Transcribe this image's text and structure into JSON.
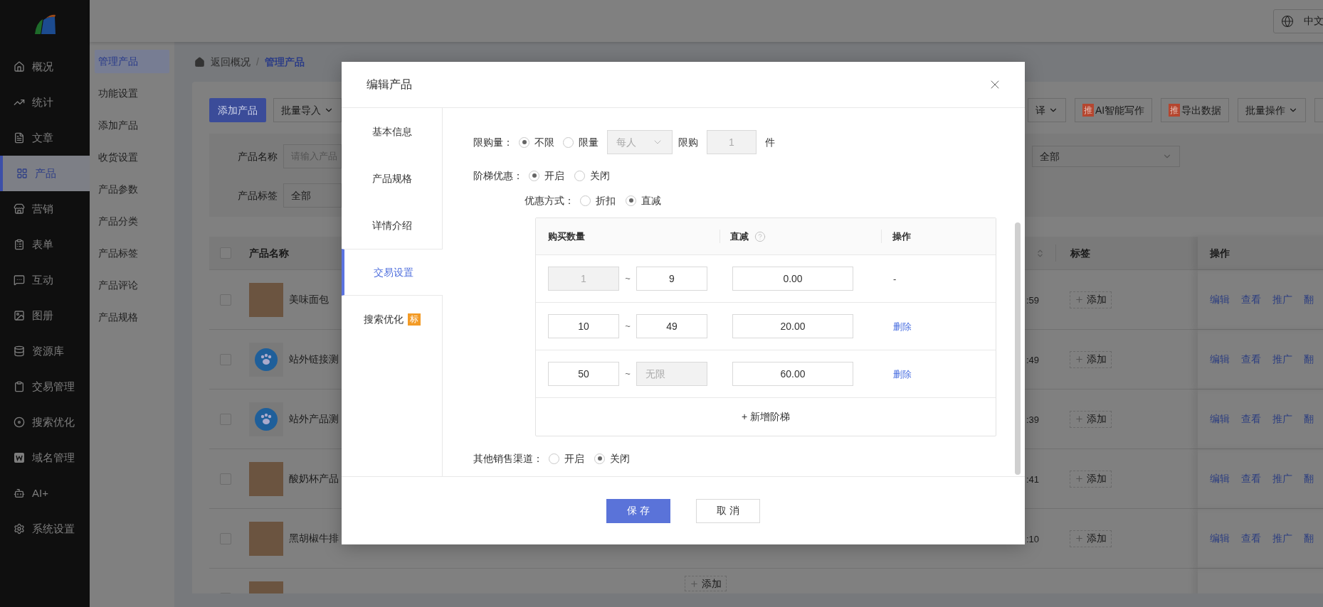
{
  "top_bar": {
    "language": "中文"
  },
  "nav": {
    "items": [
      {
        "label": "概况",
        "selected": false
      },
      {
        "label": "统计",
        "selected": false
      },
      {
        "label": "文章",
        "selected": false
      },
      {
        "label": "产品",
        "selected": true
      },
      {
        "label": "营销",
        "selected": false
      },
      {
        "label": "表单",
        "selected": false
      },
      {
        "label": "互动",
        "selected": false
      },
      {
        "label": "图册",
        "selected": false
      },
      {
        "label": "资源库",
        "selected": false
      },
      {
        "label": "交易管理",
        "selected": false
      },
      {
        "label": "搜索优化",
        "selected": false
      },
      {
        "label": "域名管理",
        "selected": false
      },
      {
        "label": "AI+",
        "selected": false
      },
      {
        "label": "系统设置",
        "selected": false
      }
    ]
  },
  "submenu": {
    "items": [
      {
        "label": "管理产品",
        "selected": true
      },
      {
        "label": "功能设置",
        "selected": false
      },
      {
        "label": "添加产品",
        "selected": false
      },
      {
        "label": "收货设置",
        "selected": false
      },
      {
        "label": "产品参数",
        "selected": false
      },
      {
        "label": "产品分类",
        "selected": false
      },
      {
        "label": "产品标签",
        "selected": false
      },
      {
        "label": "产品评论",
        "selected": false
      },
      {
        "label": "产品规格",
        "selected": false
      }
    ]
  },
  "breadcrumb": {
    "back": "返回概况",
    "separator": "/",
    "current": "管理产品"
  },
  "toolbar": {
    "left": [
      {
        "label": "添加产品",
        "kind": "primary"
      },
      {
        "label": "批量导入",
        "kind": "dropdown"
      }
    ],
    "right": [
      {
        "label": "译",
        "kind": "dropdown"
      },
      {
        "label": "AI智能写作",
        "kind": "promo",
        "badge": "推"
      },
      {
        "label": "导出数据",
        "kind": "promo",
        "badge": "推"
      },
      {
        "label": "批量操作",
        "kind": "dropdown"
      }
    ]
  },
  "filters": {
    "name": {
      "label": "产品名称",
      "placeholder": "请输入产品"
    },
    "tag": {
      "label": "产品标签",
      "value": "全部"
    },
    "other": {
      "value": "全部"
    }
  },
  "table": {
    "all_checked": false,
    "columns": {
      "name": "产品名称",
      "tag": "标签",
      "actions": "操作"
    },
    "rows": [
      {
        "checked": false,
        "kind": "photo",
        "name": "美味面包",
        "time": ":59",
        "tag_button": "添加",
        "actions": [
          "编辑",
          "查看",
          "推广",
          "翻"
        ]
      },
      {
        "checked": false,
        "kind": "logo",
        "name": "站外链接测",
        "time": ":49",
        "tag_button": "添加",
        "actions": [
          "编辑",
          "查看",
          "推广",
          "翻"
        ]
      },
      {
        "checked": false,
        "kind": "logo",
        "name": "站外产品测",
        "time": ":39",
        "tag_button": "添加",
        "actions": [
          "编辑",
          "查看",
          "推广",
          "翻"
        ]
      },
      {
        "checked": false,
        "kind": "photo",
        "name": "酸奶杯产品",
        "time": ":41",
        "tag_button": "添加",
        "actions": [
          "编辑",
          "查看",
          "推广",
          "翻"
        ]
      },
      {
        "checked": false,
        "kind": "photo",
        "name": "黑胡椒牛排",
        "time": ":10",
        "tag_button": "添加",
        "actions": [
          "编辑",
          "查看",
          "推广",
          "翻"
        ]
      },
      {
        "checked": false,
        "kind": "photo",
        "center_tag_button": "添加"
      }
    ]
  },
  "modal": {
    "title": "编辑产品",
    "tabs": [
      {
        "label": "基本信息",
        "selected": false
      },
      {
        "label": "产品规格",
        "selected": false
      },
      {
        "label": "详情介绍",
        "selected": false
      },
      {
        "label": "交易设置",
        "selected": true
      },
      {
        "label": "搜索优化",
        "selected": false,
        "badge": "标"
      }
    ],
    "purchase_limit": {
      "label": "限购量：",
      "options": [
        {
          "label": "不限",
          "selected": true
        },
        {
          "label": "限量",
          "selected": false
        }
      ],
      "per": {
        "value": "每人",
        "disabled": true
      },
      "limit_label": "限购",
      "limit": {
        "value": "1",
        "disabled": true
      },
      "unit": "件"
    },
    "tier_discount": {
      "label": "阶梯优惠：",
      "options": [
        {
          "label": "开启",
          "selected": true
        },
        {
          "label": "关闭",
          "selected": false
        }
      ]
    },
    "discount_mode": {
      "label": "优惠方式：",
      "options": [
        {
          "label": "折扣",
          "selected": false
        },
        {
          "label": "直减",
          "selected": true
        }
      ]
    },
    "tiers": {
      "columns": [
        "购买数量",
        "直减",
        "操作"
      ],
      "rows": [
        {
          "separator": "~",
          "min": {
            "value": "1",
            "disabled": true
          },
          "max": {
            "value": "9",
            "disabled": false
          },
          "amount": "0.00",
          "action": {
            "kind": "none",
            "label": "-"
          }
        },
        {
          "separator": "~",
          "min": {
            "value": "10",
            "disabled": false
          },
          "max": {
            "value": "49",
            "disabled": false
          },
          "amount": "20.00",
          "action": {
            "kind": "link",
            "label": "删除"
          }
        },
        {
          "separator": "~",
          "min": {
            "value": "50",
            "disabled": false
          },
          "max": {
            "placeholder": "无限",
            "disabled": true
          },
          "amount": "60.00",
          "action": {
            "kind": "link",
            "label": "删除"
          }
        }
      ],
      "add": "+ 新增阶梯"
    },
    "other_channels": {
      "label": "其他销售渠道：",
      "options": [
        {
          "label": "开启",
          "selected": false
        },
        {
          "label": "关闭",
          "selected": true
        }
      ]
    },
    "buttons": [
      {
        "label": "保 存",
        "kind": "primary"
      },
      {
        "label": "取 消",
        "kind": "default"
      }
    ]
  }
}
